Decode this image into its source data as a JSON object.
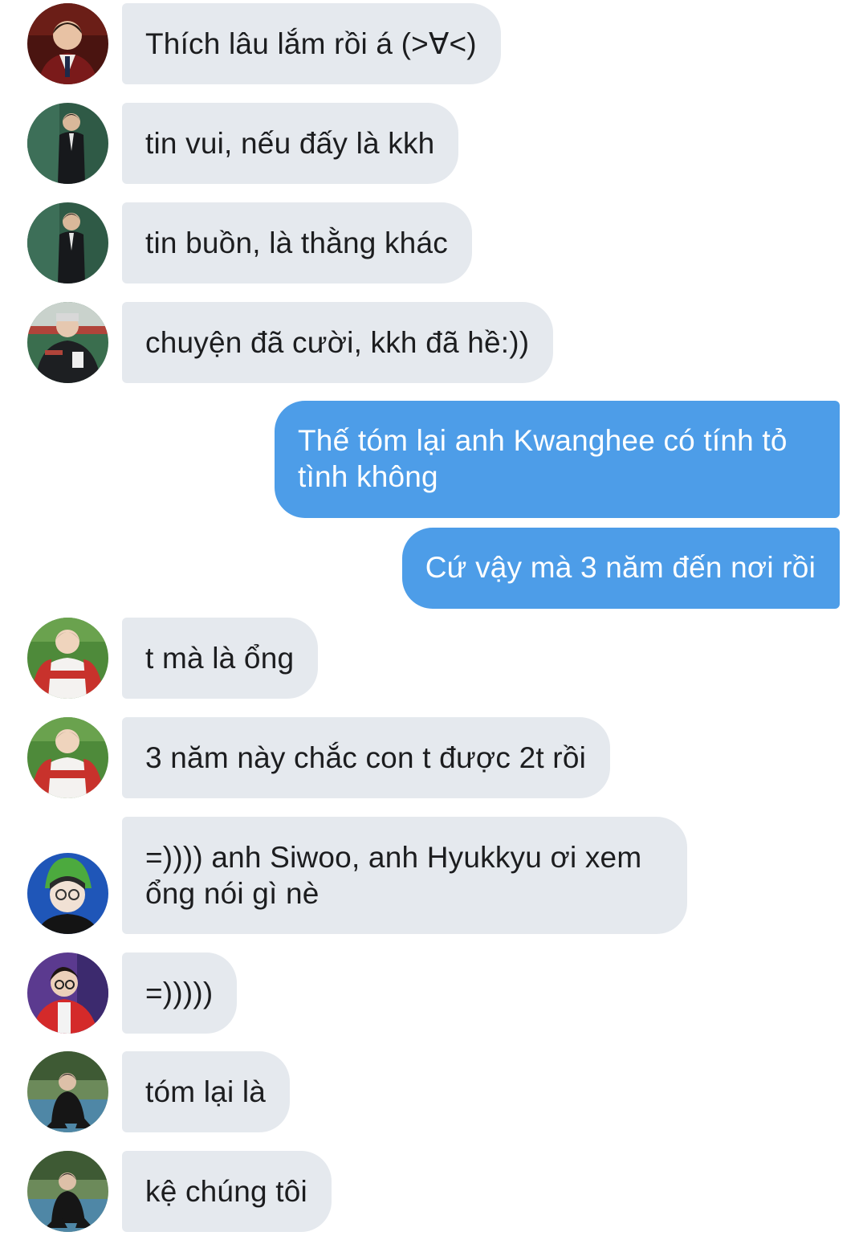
{
  "messages": [
    {
      "side": "in",
      "avatar": "avatar-user-1",
      "text": "Thích lâu lắm rồi á (>∀<)"
    },
    {
      "side": "in",
      "avatar": "avatar-user-2",
      "text": "tin vui, nếu đấy là kkh"
    },
    {
      "side": "in",
      "avatar": "avatar-user-2",
      "text": "tin buồn, là thằng khác"
    },
    {
      "side": "in",
      "avatar": "avatar-user-3",
      "text": "chuyện đã cười, kkh đã hề:))"
    },
    {
      "side": "out",
      "text": "Thế tóm lại anh Kwanghee có tính tỏ tình không"
    },
    {
      "side": "out",
      "text": "Cứ vậy mà 3 năm đến nơi rồi"
    },
    {
      "side": "in",
      "avatar": "avatar-user-4",
      "text": "t mà là ổng"
    },
    {
      "side": "in",
      "avatar": "avatar-user-4",
      "text": "3 năm này chắc con t được 2t rồi"
    },
    {
      "side": "in",
      "avatar": "avatar-user-5",
      "text": "=)))) anh Siwoo, anh Hyukkyu ơi xem ổng nói gì nè"
    },
    {
      "side": "in",
      "avatar": "avatar-user-6",
      "text": "=)))))"
    },
    {
      "side": "in",
      "avatar": "avatar-user-7",
      "text": "tóm lại là"
    },
    {
      "side": "in",
      "avatar": "avatar-user-7",
      "text": "kệ chúng tôi"
    }
  ],
  "colors": {
    "incoming_bubble": "#e5e9ee",
    "outgoing_bubble": "#4d9de8",
    "incoming_text": "#1c1d1f",
    "outgoing_text": "#ffffff",
    "background": "#ffffff"
  }
}
